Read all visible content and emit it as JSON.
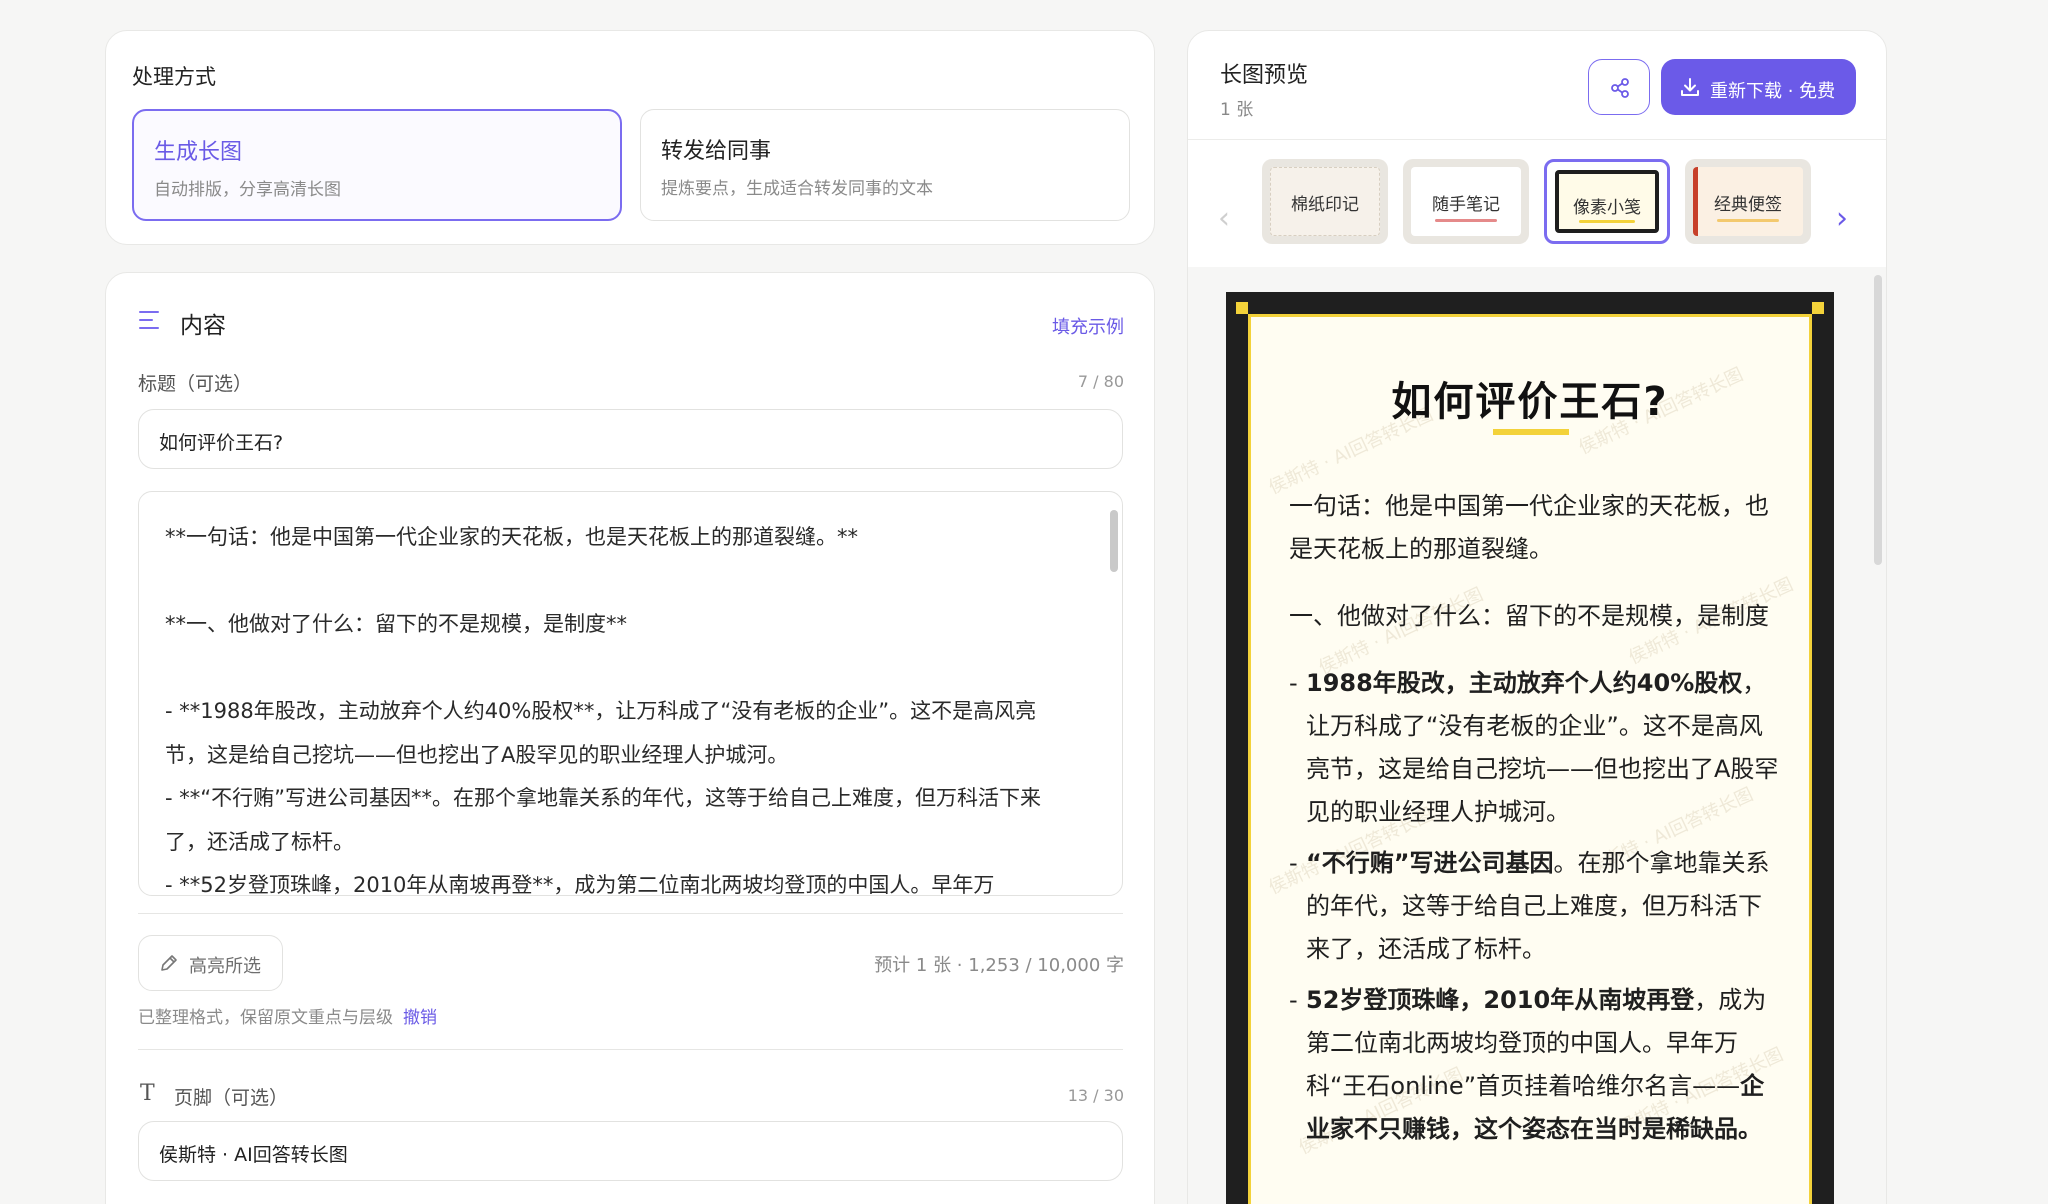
{
  "mode": {
    "title": "处理方式",
    "options": [
      {
        "title": "生成长图",
        "desc": "自动排版，分享高清长图"
      },
      {
        "title": "转发给同事",
        "desc": "提炼要点，生成适合转发同事的文本"
      }
    ]
  },
  "content": {
    "title": "内容",
    "fill_example": "填充示例",
    "title_field": {
      "label": "标题（可选）",
      "count": "7 / 80",
      "value": "如何评价王石?"
    },
    "body_text": "**一句话：他是中国第一代企业家的天花板，也是天花板上的那道裂缝。**\n\n**一、他做对了什么：留下的不是规模，是制度**\n\n- **1988年股改，主动放弃个人约40%股权**，让万科成了“没有老板的企业”。这不是高风亮节，这是给自己挖坑——但也挖出了A股罕见的职业经理人护城河。\n- **“不行贿”写进公司基因**。在那个拿地靠关系的年代，这等于给自己上难度，但万科活下来了，还活成了标杆。\n- **52岁登顶珠峰，2010年从南坡再登**，成为第二位南北两坡均登顶的中国人。早年万",
    "highlight_button": "高亮所选",
    "estimate": "预计 1 张 · 1,253 / 10,000 字",
    "note": "已整理格式，保留原文重点与层级",
    "undo": "撤销",
    "footer_field": {
      "label": "页脚（可选）",
      "count": "13 / 30",
      "value": "侯斯特 · AI回答转长图"
    }
  },
  "preview": {
    "title": "长图预览",
    "count": "1 张",
    "download": "重新下载 · 免费",
    "themes": [
      "棉纸印记",
      "随手笔记",
      "像素小笺",
      "经典便签"
    ],
    "selected_theme": "像素小笺",
    "accent": "#6b5ae8",
    "poster": {
      "title": "如何评价王石?",
      "intro": "一句话：他是中国第一代企业家的天花板，也是天花板上的那道裂缝。",
      "section": "一、他做对了什么：留下的不是规模，是制度",
      "items": [
        {
          "bold": "1988年股改，主动放弃个人约40%股权",
          "text": "，让万科成了“没有老板的企业”。这不是高风亮节，这是给自己挖坑——但也挖出了A股罕见的职业经理人护城河。"
        },
        {
          "bold": "“不行贿”写进公司基因",
          "text": "。在那个拿地靠关系的年代，这等于给自己上难度，但万科活下来了，还活成了标杆。"
        },
        {
          "bold": "52岁登顶珠峰，2010年从南坡再登",
          "text": "，成为第二位南北两坡均登顶的中国人。早年万科“王石online”首页挂着哈维尔名言——",
          "bold2": "企业家不只赚钱，这个姿态在当时是稀缺品。"
        }
      ],
      "watermark": "侯斯特 · AI回答转长图"
    }
  }
}
